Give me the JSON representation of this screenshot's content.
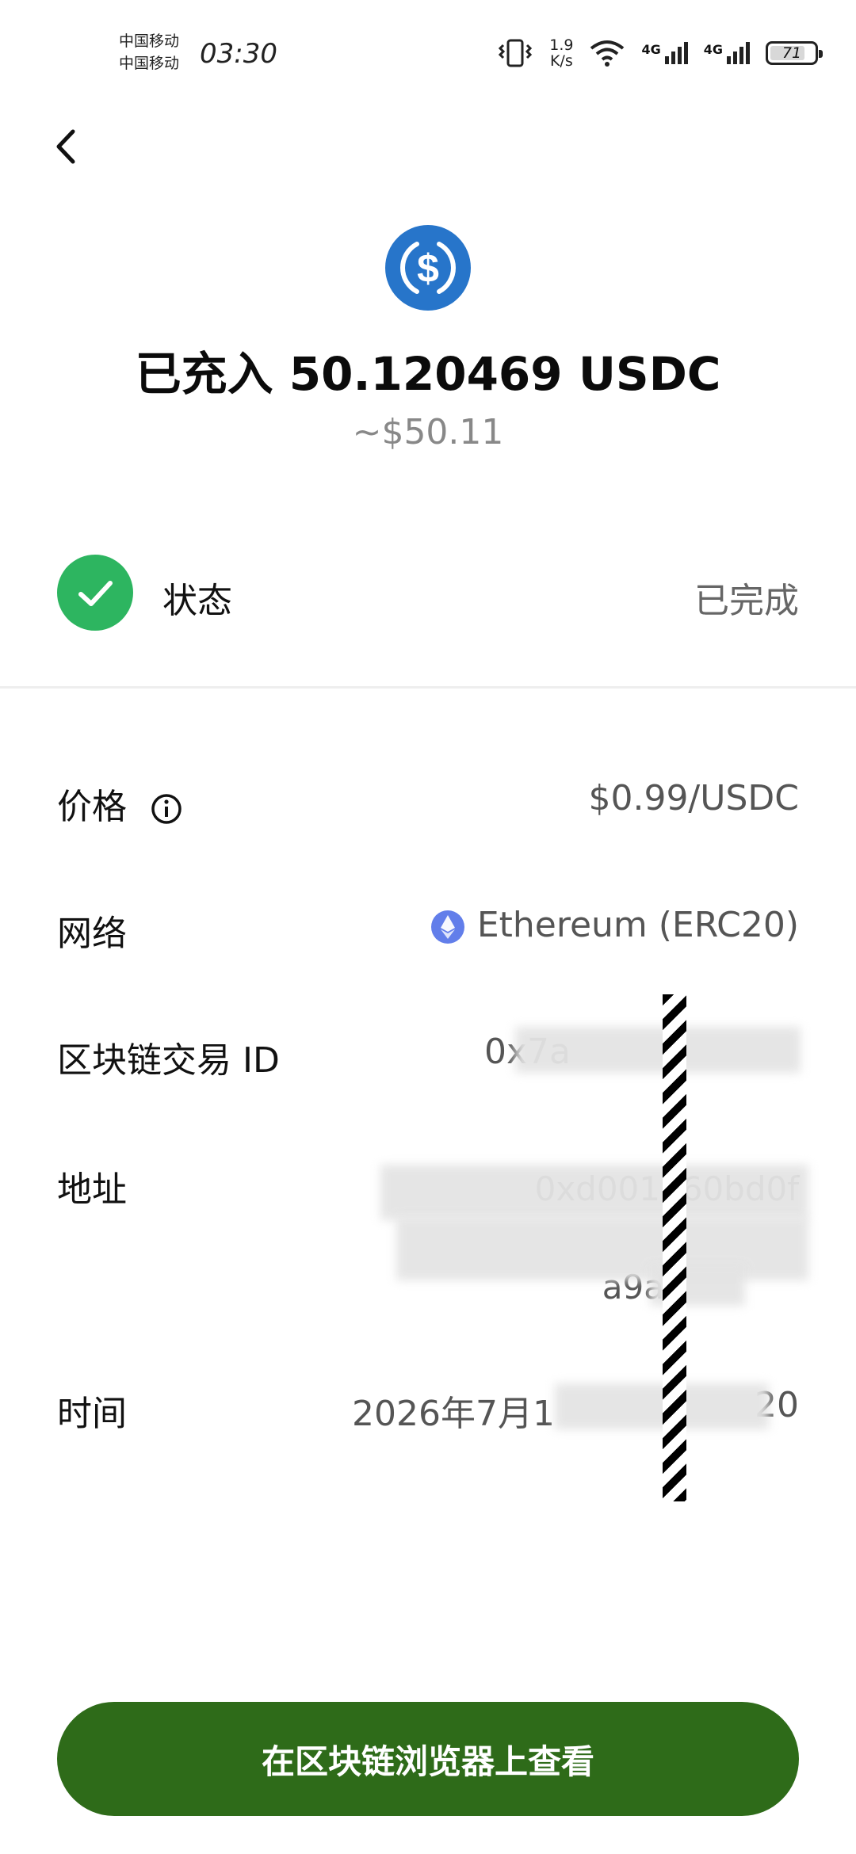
{
  "status_bar": {
    "carrier_1": "中国移动",
    "carrier_2": "中国移动",
    "time": "03:30",
    "net_speed_value": "1.9",
    "net_speed_unit": "K/s",
    "signal_1_label": "4G",
    "signal_2_label": "4G",
    "battery": "71"
  },
  "header": {
    "title": "已充入 50.120469 USDC",
    "fiat_value": "~$50.11",
    "coin_color": "#2775ca"
  },
  "status": {
    "label": "状态",
    "value": "已完成",
    "color": "#2db560"
  },
  "details": {
    "price_label": "价格",
    "price_value": "$0.99/USDC",
    "network_label": "网络",
    "network_value": "Ethereum (ERC20)",
    "txid_label": "区块链交易 ID",
    "txid_value": "0x7a",
    "address_label": "地址",
    "address_line_1": "0xd001960bd0f",
    "address_line_3": "a9a",
    "time_label": "时间",
    "time_value": "2026年7月1",
    "time_value_tail": "20"
  },
  "footer": {
    "button_label": "在区块链浏览器上查看",
    "button_color": "#2e6b19"
  }
}
